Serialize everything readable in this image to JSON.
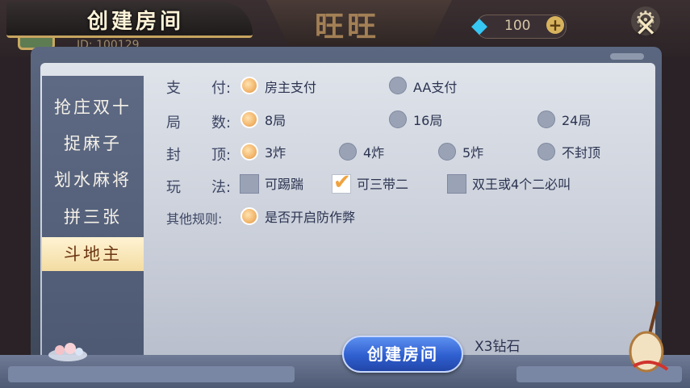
{
  "header": {
    "panel_title": "创建房间",
    "game_title": "旺旺",
    "player_id": "ID: 100129",
    "diamonds": "100"
  },
  "sidebar": {
    "items": [
      {
        "label": "抢庄双十",
        "active": false
      },
      {
        "label": "捉麻子",
        "active": false
      },
      {
        "label": "划水麻将",
        "active": false
      },
      {
        "label": "拼三张",
        "active": false
      },
      {
        "label": "斗地主",
        "active": true
      }
    ]
  },
  "rules": {
    "payment": {
      "label_a": "支",
      "label_b": "付:",
      "options": [
        {
          "text": "房主支付",
          "selected": true
        },
        {
          "text": "AA支付",
          "selected": false
        }
      ]
    },
    "rounds": {
      "label_a": "局",
      "label_b": "数:",
      "options": [
        {
          "text": "8局",
          "selected": true
        },
        {
          "text": "16局",
          "selected": false
        },
        {
          "text": "24局",
          "selected": false
        }
      ]
    },
    "cap": {
      "label_a": "封",
      "label_b": "顶:",
      "options": [
        {
          "text": "3炸",
          "selected": true
        },
        {
          "text": "4炸",
          "selected": false
        },
        {
          "text": "5炸",
          "selected": false
        },
        {
          "text": "不封顶",
          "selected": false
        }
      ]
    },
    "play": {
      "label_a": "玩",
      "label_b": "法:",
      "options": [
        {
          "text": "可踢踹",
          "checked": false
        },
        {
          "text": "可三带二",
          "checked": true
        },
        {
          "text": "双王或4个二必叫",
          "checked": false
        }
      ]
    },
    "other": {
      "label": "其他规则:",
      "options": [
        {
          "text": "是否开启防作弊",
          "selected": true
        }
      ]
    }
  },
  "footer": {
    "create_button": "创建房间",
    "cost": "X3钻石"
  },
  "colors": {
    "accent_orange": "#f2b56b",
    "button_blue": "#2f5fcf",
    "panel_bg": "#dfe3ea",
    "sidebar_bg": "#5e6a84"
  }
}
